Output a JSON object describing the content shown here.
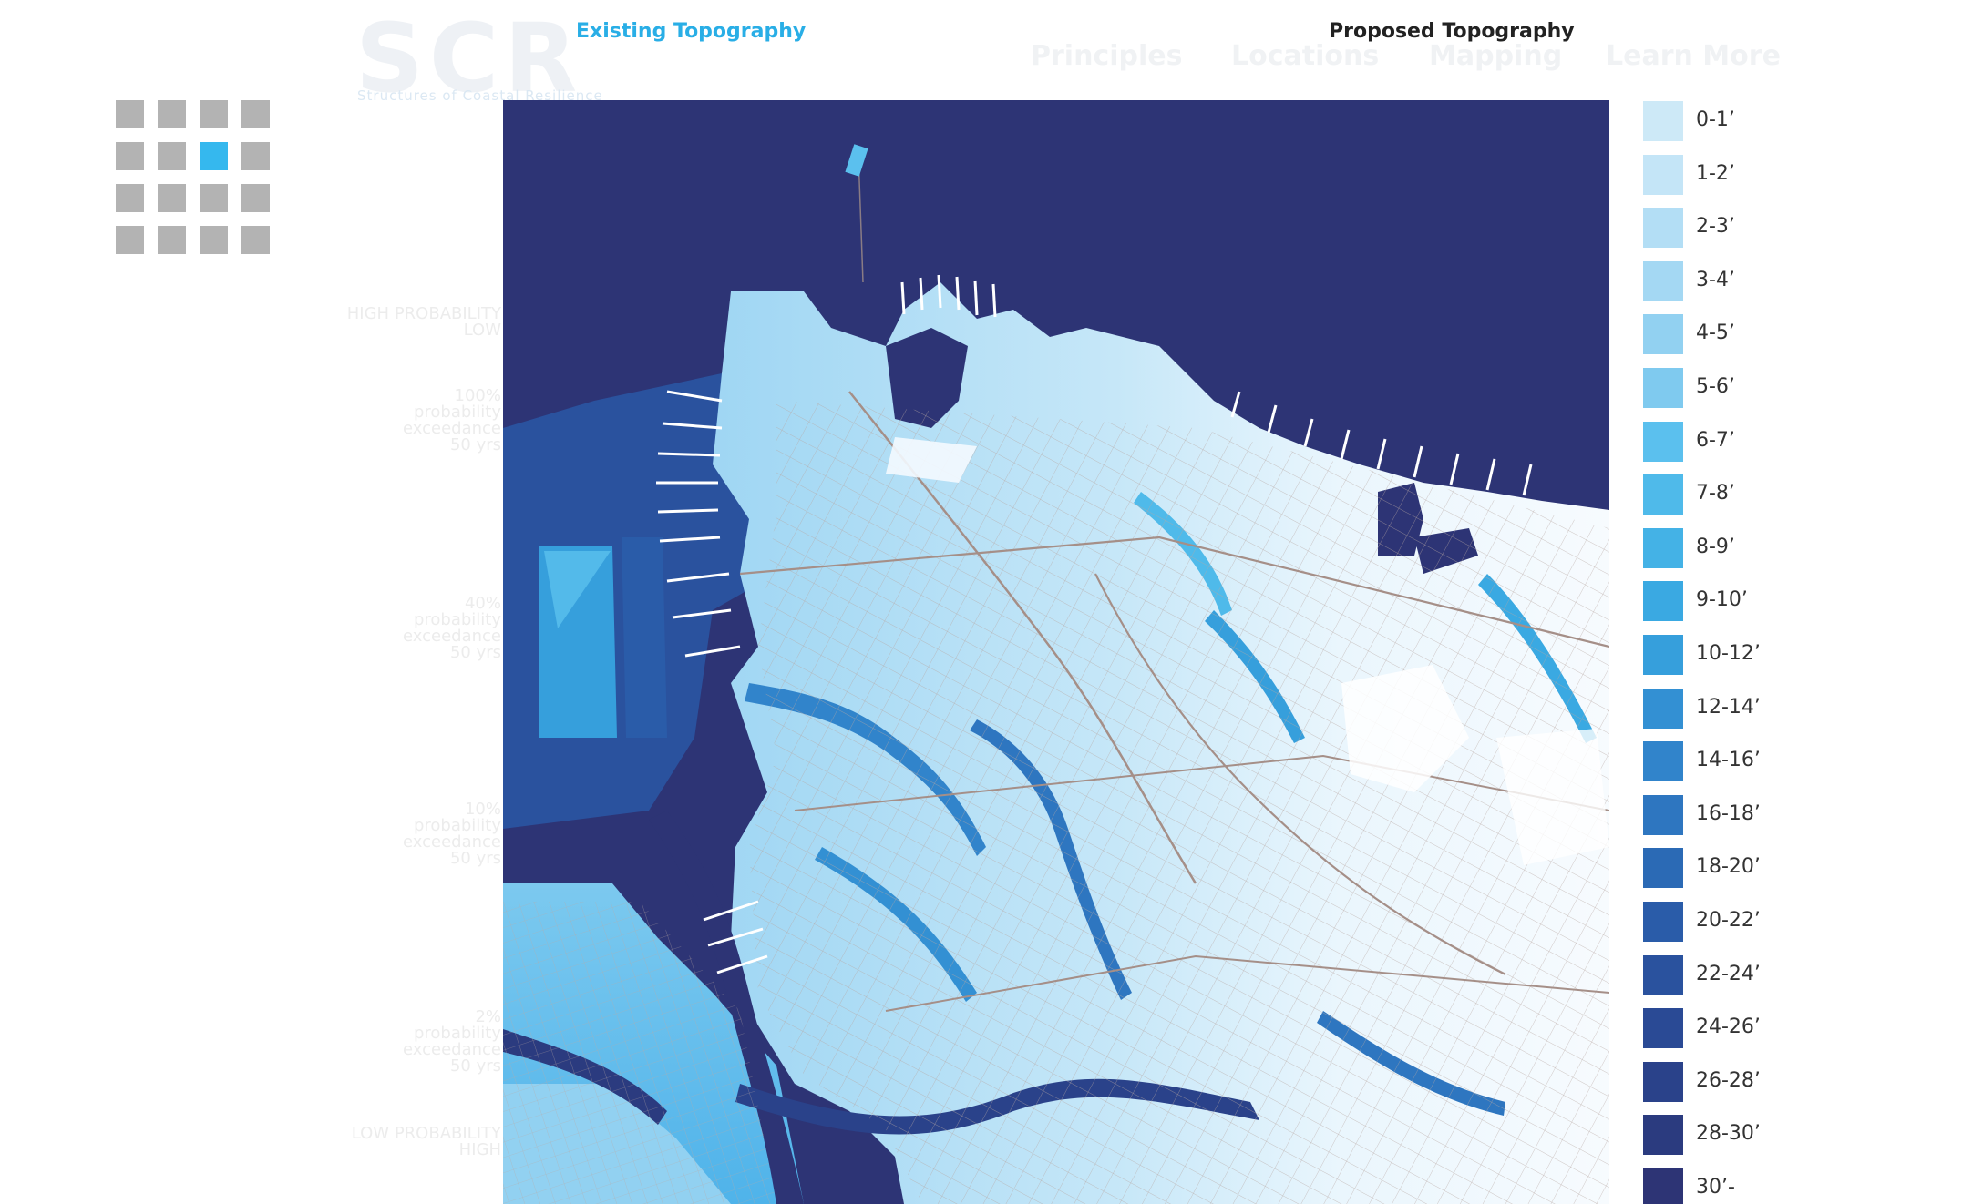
{
  "colors": {
    "accent": "#29aee6",
    "deep_water": "#2d3475",
    "land": "#ffffff",
    "roads": "#b09a94"
  },
  "background_site": {
    "logo": "SCR",
    "logo_subtitle": "Structures of Coastal Resilience",
    "nav": [
      "Principles",
      "Locations",
      "Mapping",
      "Learn More"
    ],
    "scale_labels": [
      {
        "lines": [
          "HIGH PROBABILITY",
          "LOW"
        ]
      },
      {
        "lines": [
          "100%",
          "probability",
          "exceedance",
          "50 yrs"
        ]
      },
      {
        "lines": [
          "40%",
          "probability",
          "exceedance",
          "50 yrs"
        ]
      },
      {
        "lines": [
          "10%",
          "probability",
          "exceedance",
          "50 yrs"
        ]
      },
      {
        "lines": [
          "2%",
          "probability",
          "exceedance",
          "50 yrs"
        ]
      },
      {
        "lines": [
          "LOW PROBABILITY",
          "HIGH"
        ]
      }
    ]
  },
  "tabs": {
    "existing": "Existing Topography",
    "proposed": "Proposed Topography",
    "active": "existing"
  },
  "grid_selector": {
    "rows": 4,
    "cols": 4,
    "active_row": 1,
    "active_col": 2
  },
  "legend": [
    {
      "label": "0-1’",
      "color": "#cde9f7"
    },
    {
      "label": "1-2’",
      "color": "#c4e5f7"
    },
    {
      "label": "2-3’",
      "color": "#b3def5"
    },
    {
      "label": "3-4’",
      "color": "#a4d8f3"
    },
    {
      "label": "4-5’",
      "color": "#92d1f1"
    },
    {
      "label": "5-6’",
      "color": "#7fcaef"
    },
    {
      "label": "6-7’",
      "color": "#5bc0ee"
    },
    {
      "label": "7-8’",
      "color": "#4fbaea"
    },
    {
      "label": "8-9’",
      "color": "#44b2e6"
    },
    {
      "label": "9-10’",
      "color": "#3aa9e2"
    },
    {
      "label": "10-12’",
      "color": "#369fdc"
    },
    {
      "label": "12-14’",
      "color": "#3390d3"
    },
    {
      "label": "14-16’",
      "color": "#3184cb"
    },
    {
      "label": "16-18’",
      "color": "#2e76c0"
    },
    {
      "label": "18-20’",
      "color": "#2b6ab5"
    },
    {
      "label": "20-22’",
      "color": "#2a5ca9"
    },
    {
      "label": "22-24’",
      "color": "#2a529e"
    },
    {
      "label": "24-26’",
      "color": "#2a4a95"
    },
    {
      "label": "26-28’",
      "color": "#2a428a"
    },
    {
      "label": "28-30’",
      "color": "#2b3b7f"
    },
    {
      "label": "30’-",
      "color": "#2d3475"
    }
  ]
}
